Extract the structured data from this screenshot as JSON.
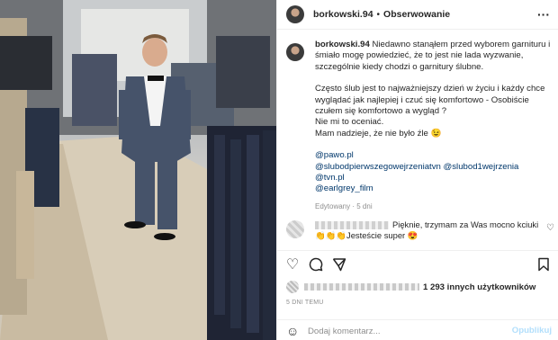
{
  "header": {
    "username": "borkowski.94",
    "separator": "•",
    "follow_label": "Obserwowanie",
    "more_icon": "more-horizontal-icon"
  },
  "caption": {
    "username": "borkowski.94",
    "paragraph1": "Niedawno stanąłem przed wyborem garnituru i śmiało mogę powiedzieć, że to jest nie lada wyzwanie, szczególnie kiedy chodzi o garnitury ślubne.",
    "paragraph2": "Często ślub jest to najważniejszy dzień w życiu i każdy chce wyglądać jak najlepiej i czuć się komfortowo - Osobiście czułem się komfortowo a wygląd ?",
    "line3": "Nie mi to oceniać.",
    "line4": "Mam nadzieje, że nie było źle 😉",
    "tags": [
      "@pawo.pl",
      "@slubodpierwszegowejrzeniatvn @slubod1wejrzenia",
      "@tvn.pl",
      "@earlgrey_film"
    ],
    "meta": "Edytowany · 5 dni"
  },
  "comment": {
    "text": "Pięknie, trzymam za Was mocno kciuki",
    "line2": "👏👏👏Jesteście super 😍",
    "like_icon": "heart-outline-icon"
  },
  "actions": {
    "like_icon": "heart-outline-icon",
    "comment_icon": "comment-bubble-icon",
    "share_icon": "paper-plane-icon",
    "save_icon": "bookmark-icon"
  },
  "likes": {
    "text": "1 293 innych użytkowników"
  },
  "time": "5 DNI TEMU",
  "add_comment": {
    "placeholder": "Dodaj komentarz...",
    "publish_label": "Opublikuj",
    "emoji_icon": "smiley-icon"
  },
  "colors": {
    "link": "#00376b",
    "muted": "#8e8e8e",
    "publish_disabled": "#b2dffc",
    "text": "#262626"
  }
}
